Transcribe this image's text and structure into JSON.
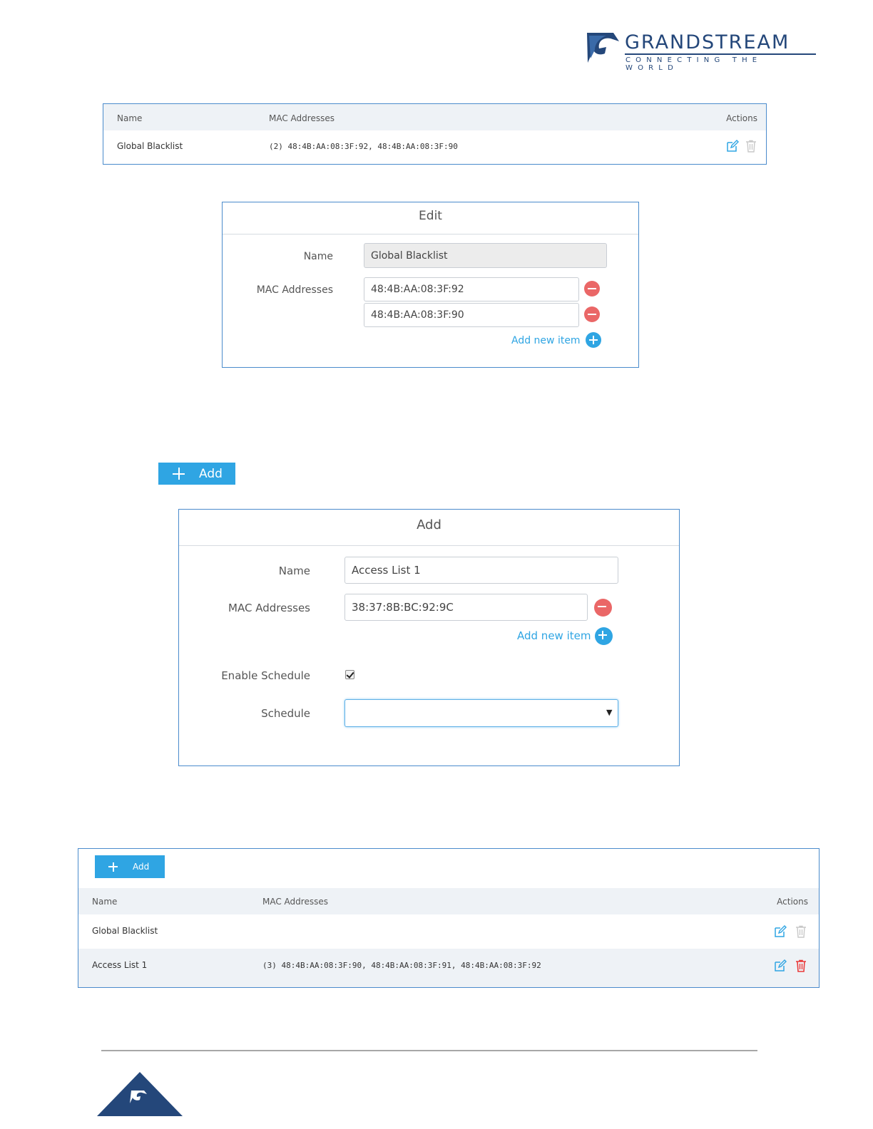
{
  "brand": {
    "name": "GRANDSTREAM",
    "tagline": "CONNECTING THE WORLD",
    "navy": "#24477a",
    "accent": "#2fa5e3",
    "danger": "#ea6767"
  },
  "table1": {
    "headers": {
      "name": "Name",
      "mac": "MAC Addresses",
      "actions": "Actions"
    },
    "rows": [
      {
        "name": "Global Blacklist",
        "mac": "(2) 48:4B:AA:08:3F:92, 48:4B:AA:08:3F:90"
      }
    ]
  },
  "edit_dialog": {
    "title": "Edit",
    "name_label": "Name",
    "name_value": "Global Blacklist",
    "mac_label": "MAC Addresses",
    "macs": [
      "48:4B:AA:08:3F:92",
      "48:4B:AA:08:3F:90"
    ],
    "add_item": "Add new item"
  },
  "add_button": {
    "label": "Add"
  },
  "add_dialog": {
    "title": "Add",
    "name_label": "Name",
    "name_value": "Access List 1",
    "mac_label": "MAC Addresses",
    "macs": [
      "38:37:8B:BC:92:9C"
    ],
    "add_item": "Add new item",
    "schedule_toggle_label": "Enable Schedule",
    "schedule_enabled": true,
    "schedule_label": "Schedule",
    "schedule_value": ""
  },
  "table2": {
    "add_label": "Add",
    "headers": {
      "name": "Name",
      "mac": "MAC Addresses",
      "actions": "Actions"
    },
    "rows": [
      {
        "name": "Global Blacklist",
        "mac": ""
      },
      {
        "name": "Access List 1",
        "mac": "(3) 48:4B:AA:08:3F:90, 48:4B:AA:08:3F:91, 48:4B:AA:08:3F:92"
      }
    ]
  }
}
